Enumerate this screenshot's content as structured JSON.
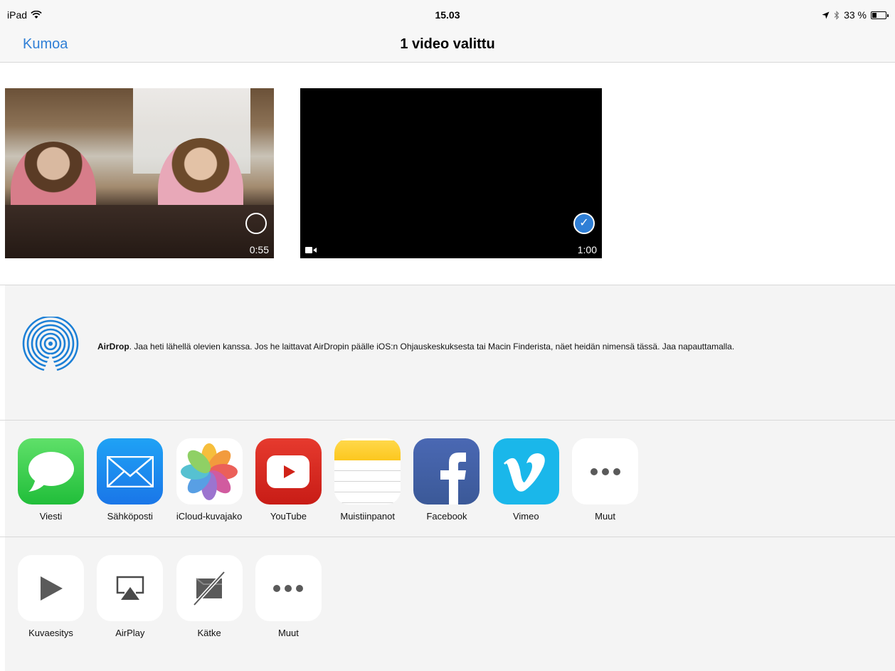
{
  "status_bar": {
    "device": "iPad",
    "time": "15.03",
    "battery": "33 %",
    "battery_level": 0.33
  },
  "nav": {
    "cancel_label": "Kumoa",
    "title": "1 video valittu"
  },
  "videos": [
    {
      "duration": "0:55",
      "selected": false
    },
    {
      "duration": "1:00",
      "selected": true
    }
  ],
  "airdrop": {
    "title": "AirDrop",
    "text": ". Jaa heti lähellä olevien kanssa. Jos he laittavat AirDropin päälle iOS:n Ohjauskeskuksesta tai Macin Finderista, näet heidän nimensä tässä. Jaa napauttamalla."
  },
  "share_apps": [
    {
      "label": "Viesti",
      "icon": "messages-icon"
    },
    {
      "label": "Sähköposti",
      "icon": "mail-icon"
    },
    {
      "label": "iCloud-kuvajako",
      "icon": "photos-icon"
    },
    {
      "label": "YouTube",
      "icon": "youtube-icon"
    },
    {
      "label": "Muistiinpanot",
      "icon": "notes-icon"
    },
    {
      "label": "Facebook",
      "icon": "facebook-icon"
    },
    {
      "label": "Vimeo",
      "icon": "vimeo-icon"
    },
    {
      "label": "Muut",
      "icon": "more-icon"
    }
  ],
  "actions": [
    {
      "label": "Kuvaesitys",
      "icon": "play-icon"
    },
    {
      "label": "AirPlay",
      "icon": "airplay-icon"
    },
    {
      "label": "Kätke",
      "icon": "hide-icon"
    },
    {
      "label": "Muut",
      "icon": "more-icon"
    }
  ],
  "colors": {
    "accent": "#2f7fd6",
    "panel_bg": "#f4f4f4"
  }
}
